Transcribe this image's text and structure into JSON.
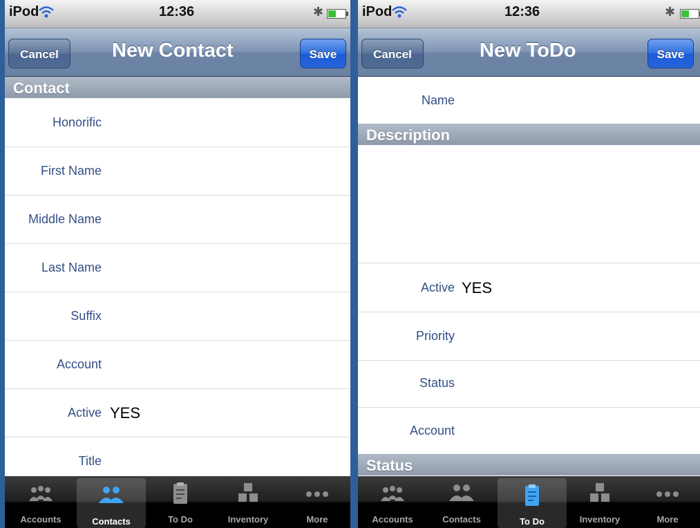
{
  "left": {
    "status": {
      "carrier": "iPod",
      "time": "12:36"
    },
    "nav": {
      "cancel": "Cancel",
      "title": "New Contact",
      "save": "Save"
    },
    "section": "Contact",
    "rows": [
      {
        "label": "Honorific",
        "value": ""
      },
      {
        "label": "First Name",
        "value": ""
      },
      {
        "label": "Middle Name",
        "value": ""
      },
      {
        "label": "Last Name",
        "value": ""
      },
      {
        "label": "Suffix",
        "value": ""
      },
      {
        "label": "Account",
        "value": ""
      },
      {
        "label": "Active",
        "value": "YES"
      },
      {
        "label": "Title",
        "value": ""
      }
    ],
    "tabs": [
      {
        "label": "Accounts",
        "icon": "accounts-icon",
        "active": false
      },
      {
        "label": "Contacts",
        "icon": "contacts-icon",
        "active": true
      },
      {
        "label": "To Do",
        "icon": "todo-icon",
        "active": false
      },
      {
        "label": "Inventory",
        "icon": "inventory-icon",
        "active": false
      },
      {
        "label": "More",
        "icon": "more-icon",
        "active": false
      }
    ]
  },
  "right": {
    "status": {
      "carrier": "iPod",
      "time": "12:36"
    },
    "nav": {
      "cancel": "Cancel",
      "title": "New ToDo",
      "save": "Save"
    },
    "name_row": {
      "label": "Name",
      "value": ""
    },
    "section_description": "Description",
    "rows": [
      {
        "label": "Active",
        "value": "YES"
      },
      {
        "label": "Priority",
        "value": ""
      },
      {
        "label": "Status",
        "value": ""
      },
      {
        "label": "Account",
        "value": ""
      }
    ],
    "section_status": "Status",
    "tabs": [
      {
        "label": "Accounts",
        "icon": "accounts-icon",
        "active": false
      },
      {
        "label": "Contacts",
        "icon": "contacts-icon",
        "active": false
      },
      {
        "label": "To Do",
        "icon": "todo-icon",
        "active": true
      },
      {
        "label": "Inventory",
        "icon": "inventory-icon",
        "active": false
      },
      {
        "label": "More",
        "icon": "more-icon",
        "active": false
      }
    ]
  },
  "colors": {
    "accent": "#324f85",
    "navbar": "#6c84a6",
    "save_button": "#2664dc",
    "background": "#2f5f9a"
  }
}
